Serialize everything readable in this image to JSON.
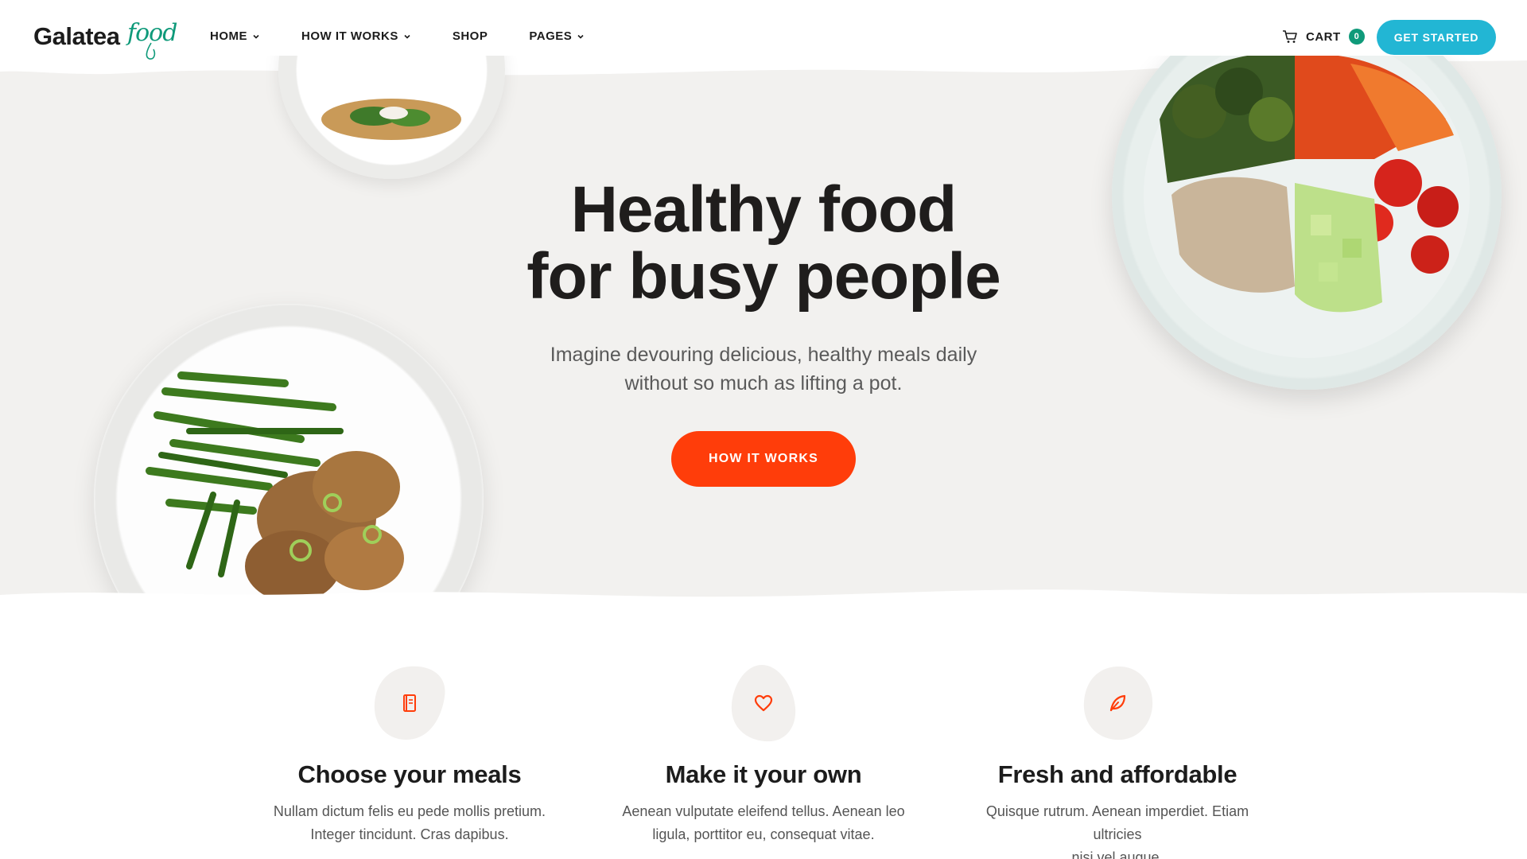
{
  "brand": {
    "name_main": "Galatea",
    "name_script": "food",
    "accent": "#0f9a7a"
  },
  "nav": {
    "items": [
      {
        "label": "HOME",
        "has_dropdown": true
      },
      {
        "label": "HOW IT WORKS",
        "has_dropdown": true
      },
      {
        "label": "SHOP",
        "has_dropdown": false
      },
      {
        "label": "PAGES",
        "has_dropdown": true
      }
    ],
    "cart_label": "CART",
    "cart_count": "0",
    "cta_label": "GET STARTED",
    "cta_color": "#22b6d4"
  },
  "hero": {
    "title_line1": "Healthy food",
    "title_line2": "for busy people",
    "subtitle_line1": "Imagine devouring delicious, healthy meals daily",
    "subtitle_line2": "without so much as lifting a pot.",
    "button_label": "HOW IT WORKS",
    "button_color": "#ff3d0a"
  },
  "features": [
    {
      "icon": "book-icon",
      "title": "Choose your meals",
      "text_line1": "Nullam dictum felis eu pede mollis pretium.",
      "text_line2": "Integer tincidunt. Cras dapibus."
    },
    {
      "icon": "heart-icon",
      "title": "Make it your own",
      "text_line1": "Aenean vulputate eleifend tellus. Aenean leo",
      "text_line2": "ligula, porttitor eu, consequat vitae."
    },
    {
      "icon": "leaf-icon",
      "title": "Fresh and affordable",
      "text_line1": "Quisque rutrum. Aenean imperdiet. Etiam ultricies",
      "text_line2": "nisi vel augue."
    }
  ]
}
